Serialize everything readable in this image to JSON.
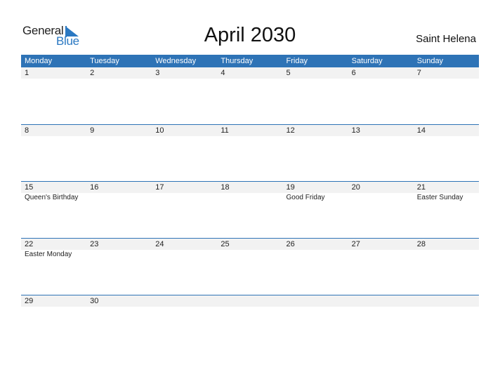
{
  "brand": {
    "line1": "General",
    "line2": "Blue",
    "accent": "#2a78c2"
  },
  "title": "April 2030",
  "region": "Saint Helena",
  "colors": {
    "header_bg": "#2e73b6",
    "date_strip_bg": "#f2f2f2"
  },
  "weekdays": [
    "Monday",
    "Tuesday",
    "Wednesday",
    "Thursday",
    "Friday",
    "Saturday",
    "Sunday"
  ],
  "weeks": [
    {
      "dates": [
        "1",
        "2",
        "3",
        "4",
        "5",
        "6",
        "7"
      ],
      "events": [
        "",
        "",
        "",
        "",
        "",
        "",
        ""
      ]
    },
    {
      "dates": [
        "8",
        "9",
        "10",
        "11",
        "12",
        "13",
        "14"
      ],
      "events": [
        "",
        "",
        "",
        "",
        "",
        "",
        ""
      ]
    },
    {
      "dates": [
        "15",
        "16",
        "17",
        "18",
        "19",
        "20",
        "21"
      ],
      "events": [
        "Queen's Birthday",
        "",
        "",
        "",
        "Good Friday",
        "",
        "Easter Sunday"
      ]
    },
    {
      "dates": [
        "22",
        "23",
        "24",
        "25",
        "26",
        "27",
        "28"
      ],
      "events": [
        "Easter Monday",
        "",
        "",
        "",
        "",
        "",
        ""
      ]
    },
    {
      "dates": [
        "29",
        "30",
        "",
        "",
        "",
        "",
        ""
      ],
      "events": [
        "",
        "",
        "",
        "",
        "",
        "",
        ""
      ]
    }
  ]
}
